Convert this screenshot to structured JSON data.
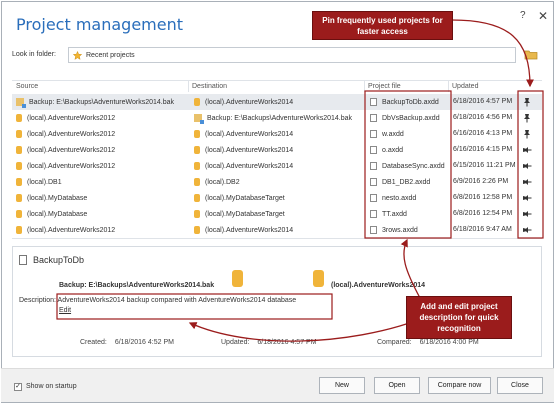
{
  "window": {
    "title": "Project management",
    "help": "?",
    "close": "✕"
  },
  "lookin": {
    "label": "Look in folder:",
    "value": "Recent projects"
  },
  "columns": {
    "source": "Source",
    "destination": "Destination",
    "project_file": "Project file",
    "updated": "Updated"
  },
  "rows": [
    {
      "source": "Backup: E:\\Backups\\AdventureWorks2014.bak",
      "destination": "(local).AdventureWorks2014",
      "file": "BackupToDb.axdd",
      "updated": "6/18/2016 4:57 PM",
      "source_kind": "backup",
      "dest_kind": "db",
      "pinned": true
    },
    {
      "source": "(local).AdventureWorks2012",
      "destination": "Backup: E:\\Backups\\AdventureWorks2014.bak",
      "file": "DbVsBackup.axdd",
      "updated": "6/18/2016 4:56 PM",
      "source_kind": "db",
      "dest_kind": "backup",
      "pinned": true
    },
    {
      "source": "(local).AdventureWorks2012",
      "destination": "(local).AdventureWorks2014",
      "file": "w.axdd",
      "updated": "6/16/2016 4:13 PM",
      "source_kind": "db",
      "dest_kind": "db",
      "pinned": true
    },
    {
      "source": "(local).AdventureWorks2012",
      "destination": "(local).AdventureWorks2014",
      "file": "o.axdd",
      "updated": "6/16/2016 4:15 PM",
      "source_kind": "db",
      "dest_kind": "db",
      "pinned": false
    },
    {
      "source": "(local).AdventureWorks2012",
      "destination": "(local).AdventureWorks2014",
      "file": "DatabaseSync.axdd",
      "updated": "6/15/2016 11:21 PM",
      "source_kind": "db",
      "dest_kind": "db",
      "pinned": false
    },
    {
      "source": "(local).DB1",
      "destination": "(local).DB2",
      "file": "DB1_DB2.axdd",
      "updated": "6/9/2016 2:26 PM",
      "source_kind": "db",
      "dest_kind": "db",
      "pinned": false
    },
    {
      "source": "(local).MyDatabase",
      "destination": "(local).MyDatabaseTarget",
      "file": "nesto.axdd",
      "updated": "6/8/2016 12:58 PM",
      "source_kind": "db",
      "dest_kind": "db",
      "pinned": false
    },
    {
      "source": "(local).MyDatabase",
      "destination": "(local).MyDatabaseTarget",
      "file": "TT.axdd",
      "updated": "6/8/2016 12:54 PM",
      "source_kind": "db",
      "dest_kind": "db",
      "pinned": false
    },
    {
      "source": "(local).AdventureWorks2012",
      "destination": "(local).AdventureWorks2014",
      "file": "3rows.axdd",
      "updated": "6/18/2016 9:47 AM",
      "source_kind": "db",
      "dest_kind": "db",
      "pinned": false
    }
  ],
  "details": {
    "name": "BackupToDb",
    "source": "Backup: E:\\Backups\\AdventureWorks2014.bak",
    "target": "(local).AdventureWorks2014",
    "description_label": "Description:",
    "description": "AdventureWorks2014 backup compared with AdventureWorks2014 database",
    "edit": "Edit",
    "created_label": "Created:",
    "created": "6/18/2016 4:52 PM",
    "updated_label": "Updated:",
    "updated": "6/18/2016 4:57 PM",
    "compared_label": "Compared:",
    "compared": "6/18/2016 4:00 PM"
  },
  "footer": {
    "show_on_startup": "Show on startup",
    "show_on_startup_checked": true,
    "new": "New",
    "open": "Open",
    "compare_now": "Compare now",
    "close": "Close"
  },
  "callouts": {
    "pin": "Pin frequently used projects for faster access",
    "desc": "Add and edit project description for quick recognition"
  },
  "colors": {
    "accent": "#2a6ebb",
    "annotation": "#9b1c1c",
    "db": "#f0b43a",
    "selected_row": "#e7eaee"
  }
}
